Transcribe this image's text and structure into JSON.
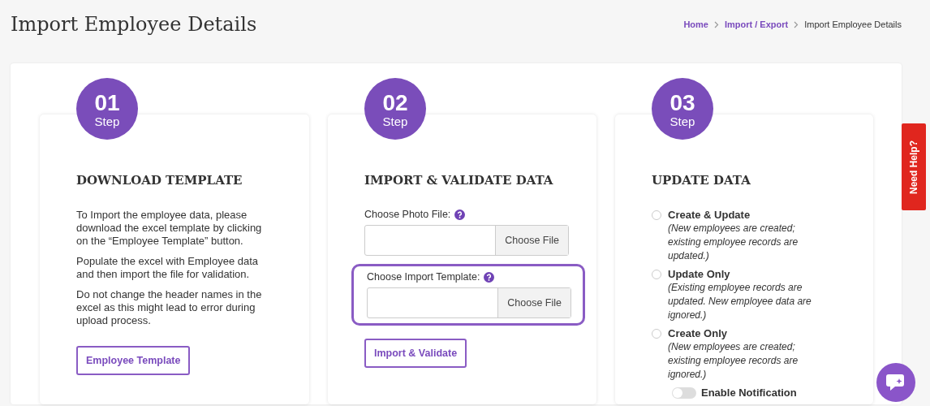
{
  "page_title": "Import Employee Details",
  "breadcrumb": [
    {
      "label": "Home",
      "link": true
    },
    {
      "label": "Import / Export",
      "link": true
    },
    {
      "label": "Import Employee Details",
      "link": false
    }
  ],
  "steps": [
    {
      "kind": "download",
      "number": "01",
      "step_label": "Step",
      "heading": "DOWNLOAD TEMPLATE",
      "paragraphs": [
        "To Import the employee data, please download the excel template by clicking on the “Employee Template” button.",
        "Populate the excel with Employee data and then import the file for validation.",
        "Do not change the header names in the excel as this might lead to error during upload process."
      ],
      "button": "Employee Template"
    },
    {
      "kind": "import",
      "number": "02",
      "step_label": "Step",
      "heading": "IMPORT & VALIDATE DATA",
      "fields": [
        {
          "label": "Choose Photo File:",
          "button": "Choose File",
          "highlighted": false
        },
        {
          "label": "Choose Import Template:",
          "button": "Choose File",
          "highlighted": true
        }
      ],
      "button": "Import & Validate"
    },
    {
      "kind": "update",
      "number": "03",
      "step_label": "Step",
      "heading": "UPDATE DATA",
      "options": [
        {
          "label": "Create & Update",
          "note": "(New employees are created; existing employee records are updated.)",
          "selected": false
        },
        {
          "label": "Update Only",
          "note": "(Existing employee records are updated. New employee data are ignored.)",
          "selected": false
        },
        {
          "label": "Create Only",
          "note": "(New employees are created; existing employee records are ignored.)",
          "selected": false
        }
      ],
      "toggle": {
        "label": "Enable Notification",
        "on": false
      }
    }
  ],
  "help_tab": "Need Help?"
}
